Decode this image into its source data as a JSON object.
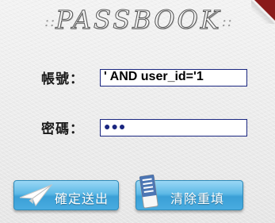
{
  "app": {
    "title": "PASSBOOK",
    "title_decor_left": "::",
    "title_decor_right": "::"
  },
  "form": {
    "account_label": "帳號：",
    "account_value": "' AND user_id='1",
    "password_label": "密碼：",
    "password_value": "●●●"
  },
  "buttons": {
    "submit_label": "確定送出",
    "clear_label": "清除重填"
  },
  "icons": {
    "submit_icon": "paper-plane-icon",
    "clear_icon": "eraser-icon"
  },
  "colors": {
    "field_border": "#1a2680",
    "button_blue": "#49ace0",
    "corner_ribbon": "#8a1a1a"
  }
}
